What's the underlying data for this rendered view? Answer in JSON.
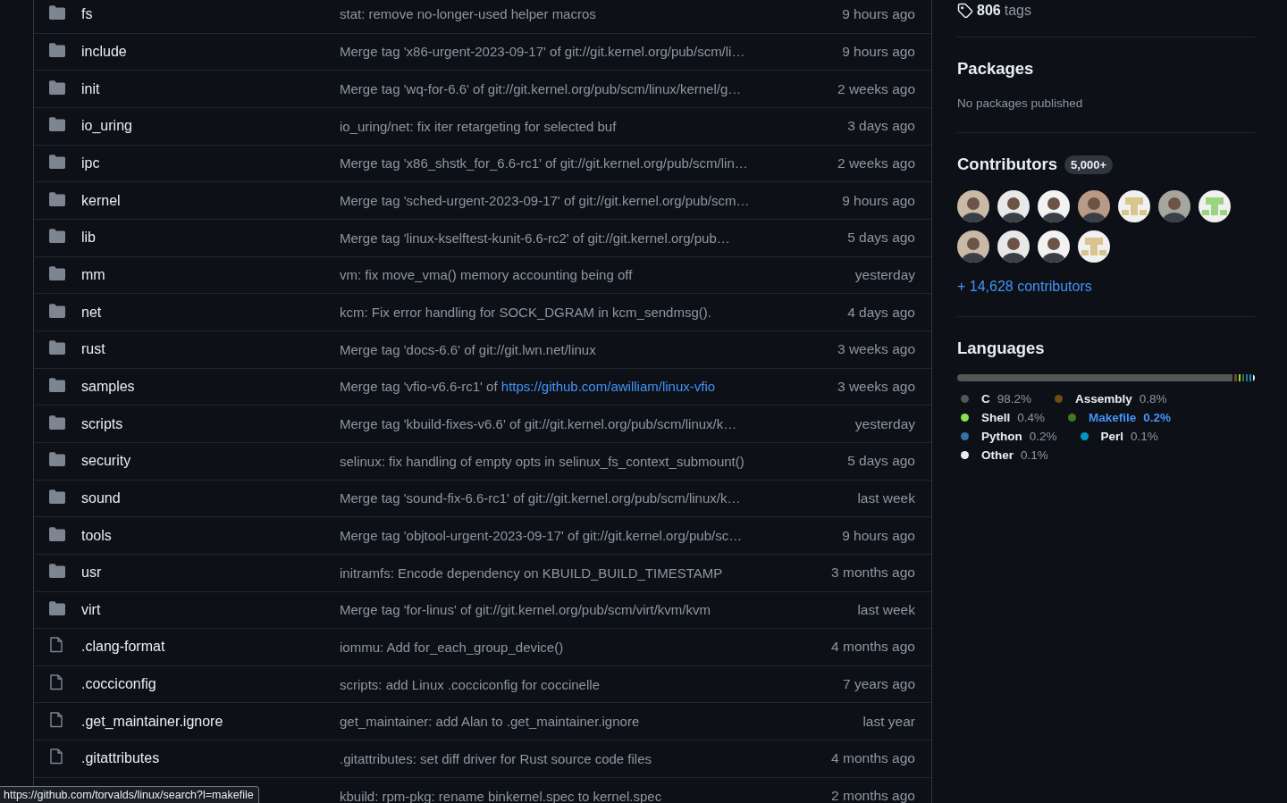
{
  "files": [
    {
      "kind": "folder",
      "name": "fs",
      "message": "stat: remove no-longer-used helper macros",
      "time": "9 hours ago"
    },
    {
      "kind": "folder",
      "name": "include",
      "message": "Merge tag 'x86-urgent-2023-09-17' of git://git.kernel.org/pub/scm/li…",
      "time": "9 hours ago"
    },
    {
      "kind": "folder",
      "name": "init",
      "message": "Merge tag 'wq-for-6.6' of git://git.kernel.org/pub/scm/linux/kernel/g…",
      "time": "2 weeks ago"
    },
    {
      "kind": "folder",
      "name": "io_uring",
      "message": "io_uring/net: fix iter retargeting for selected buf",
      "time": "3 days ago"
    },
    {
      "kind": "folder",
      "name": "ipc",
      "message": "Merge tag 'x86_shstk_for_6.6-rc1' of git://git.kernel.org/pub/scm/lin…",
      "time": "2 weeks ago"
    },
    {
      "kind": "folder",
      "name": "kernel",
      "message": "Merge tag 'sched-urgent-2023-09-17' of git://git.kernel.org/pub/scm…",
      "time": "9 hours ago"
    },
    {
      "kind": "folder",
      "name": "lib",
      "message": "Merge tag 'linux-kselftest-kunit-6.6-rc2' of git://git.kernel.org/pub…",
      "time": "5 days ago"
    },
    {
      "kind": "folder",
      "name": "mm",
      "message": "vm: fix move_vma() memory accounting being off",
      "time": "yesterday"
    },
    {
      "kind": "folder",
      "name": "net",
      "message": "kcm: Fix error handling for SOCK_DGRAM in kcm_sendmsg().",
      "time": "4 days ago"
    },
    {
      "kind": "folder",
      "name": "rust",
      "message": "Merge tag 'docs-6.6' of git://git.lwn.net/linux",
      "time": "3 weeks ago"
    },
    {
      "kind": "folder",
      "name": "samples",
      "message": "Merge tag 'vfio-v6.6-rc1' of",
      "link": "https://github.com/awilliam/linux-vfio",
      "time": "3 weeks ago"
    },
    {
      "kind": "folder",
      "name": "scripts",
      "message": "Merge tag 'kbuild-fixes-v6.6' of git://git.kernel.org/pub/scm/linux/k…",
      "time": "yesterday"
    },
    {
      "kind": "folder",
      "name": "security",
      "message": "selinux: fix handling of empty opts in selinux_fs_context_submount()",
      "time": "5 days ago"
    },
    {
      "kind": "folder",
      "name": "sound",
      "message": "Merge tag 'sound-fix-6.6-rc1' of git://git.kernel.org/pub/scm/linux/k…",
      "time": "last week"
    },
    {
      "kind": "folder",
      "name": "tools",
      "message": "Merge tag 'objtool-urgent-2023-09-17' of git://git.kernel.org/pub/sc…",
      "time": "9 hours ago"
    },
    {
      "kind": "folder",
      "name": "usr",
      "message": "initramfs: Encode dependency on KBUILD_BUILD_TIMESTAMP",
      "time": "3 months ago"
    },
    {
      "kind": "folder",
      "name": "virt",
      "message": "Merge tag 'for-linus' of git://git.kernel.org/pub/scm/virt/kvm/kvm",
      "time": "last week"
    },
    {
      "kind": "file",
      "name": ".clang-format",
      "message": "iommu: Add for_each_group_device()",
      "time": "4 months ago"
    },
    {
      "kind": "file",
      "name": ".cocciconfig",
      "message": "scripts: add Linux .cocciconfig for coccinelle",
      "time": "7 years ago"
    },
    {
      "kind": "file",
      "name": ".get_maintainer.ignore",
      "message": "get_maintainer: add Alan to .get_maintainer.ignore",
      "time": "last year"
    },
    {
      "kind": "file",
      "name": ".gitattributes",
      "message": ".gitattributes: set diff driver for Rust source code files",
      "time": "4 months ago"
    },
    {
      "message": "kbuild: rpm-pkg: rename binkernel.spec to kernel.spec",
      "time": "2 months ago"
    }
  ],
  "tags": {
    "count": "806",
    "label": "tags"
  },
  "packages": {
    "title": "Packages",
    "text": "No packages published"
  },
  "contributors": {
    "title": "Contributors",
    "badge": "5,000+",
    "more": "+ 14,628 contributors",
    "avatars": [
      {
        "kind": "photo"
      },
      {
        "kind": "photo"
      },
      {
        "kind": "photo"
      },
      {
        "kind": "photo"
      },
      {
        "kind": "identicon"
      },
      {
        "kind": "photo"
      },
      {
        "kind": "identicon"
      },
      {
        "kind": "photo"
      },
      {
        "kind": "photo"
      },
      {
        "kind": "photo"
      },
      {
        "kind": "identicon"
      }
    ]
  },
  "languages": {
    "title": "Languages",
    "items": [
      {
        "name": "C",
        "percent": "98.2%",
        "color": "#555555",
        "hovered": false
      },
      {
        "name": "Assembly",
        "percent": "0.8%",
        "color": "#6e4c13",
        "hovered": false
      },
      {
        "name": "Shell",
        "percent": "0.4%",
        "color": "#89e051",
        "hovered": false
      },
      {
        "name": "Makefile",
        "percent": "0.2%",
        "color": "#427819",
        "hovered": true
      },
      {
        "name": "Python",
        "percent": "0.2%",
        "color": "#3572a5",
        "hovered": false
      },
      {
        "name": "Perl",
        "percent": "0.1%",
        "color": "#0298c3",
        "hovered": false
      },
      {
        "name": "Other",
        "percent": "0.1%",
        "color": "#ededed",
        "hovered": false
      }
    ]
  },
  "status_url": "https://github.com/torvalds/linux/search?l=makefile"
}
